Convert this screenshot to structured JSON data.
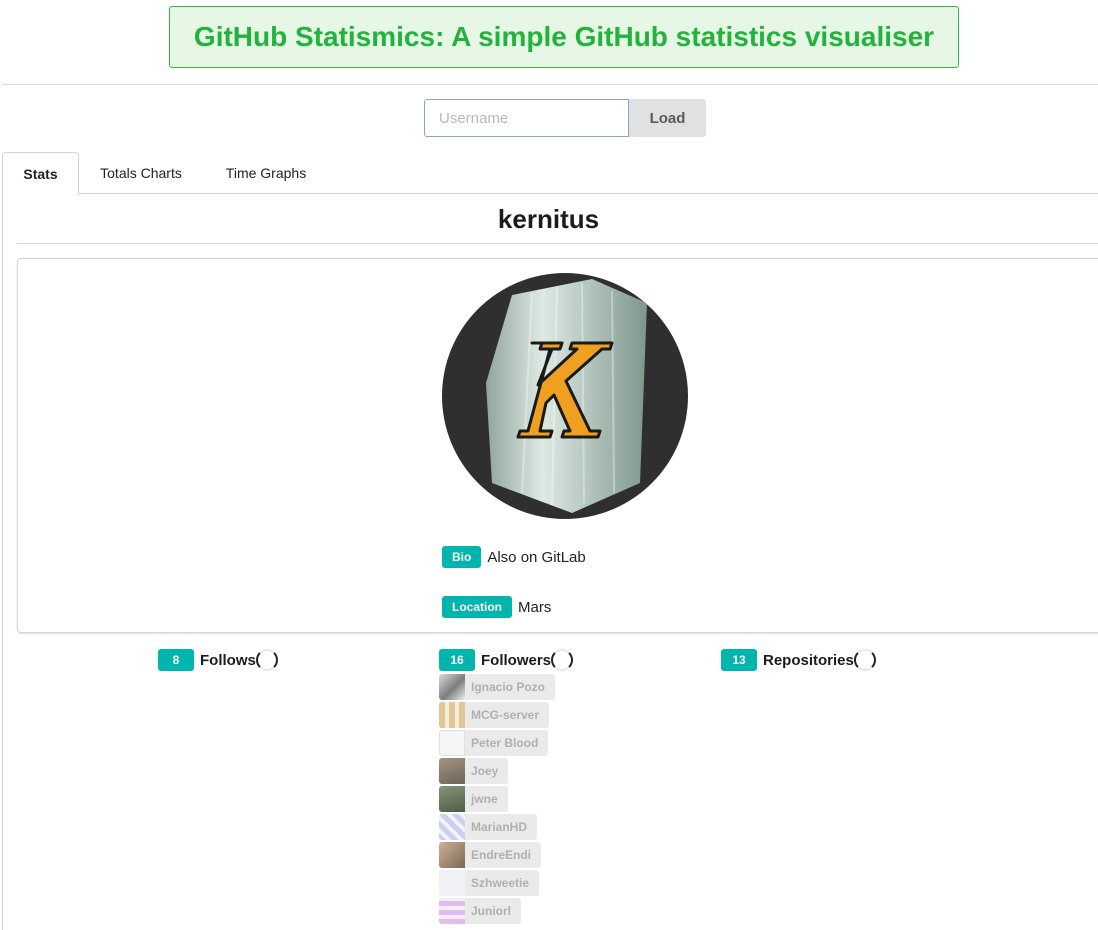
{
  "header": {
    "title": "GitHub Statismics: A simple GitHub statistics visualiser"
  },
  "search": {
    "placeholder": "Username",
    "value": "",
    "load_label": "Load"
  },
  "tabs": [
    {
      "label": "Stats",
      "active": true
    },
    {
      "label": "Totals Charts",
      "active": false
    },
    {
      "label": "Time Graphs",
      "active": false
    }
  ],
  "profile": {
    "username": "kernitus",
    "avatar_letter": "K",
    "bio_label": "Bio",
    "bio": "Also on GitLab",
    "location_label": "Location",
    "location": "Mars"
  },
  "stats": {
    "follows": {
      "count": "8",
      "label": "Follows"
    },
    "followers": {
      "count": "16",
      "label": "Followers"
    },
    "repositories": {
      "count": "13",
      "label": "Repositories"
    }
  },
  "followers_list": [
    {
      "name": "Ignacio Pozo",
      "icon": "person-photo-icon"
    },
    {
      "name": "MCG-server",
      "icon": "identicon-icon"
    },
    {
      "name": "Peter Blood",
      "icon": "logo-icon"
    },
    {
      "name": "Joey",
      "icon": "person-photo-icon"
    },
    {
      "name": "jwne",
      "icon": "person-photo-icon"
    },
    {
      "name": "MarianHD",
      "icon": "identicon-icon"
    },
    {
      "name": "EndreEndi",
      "icon": "photo-icon"
    },
    {
      "name": "Szhweetie",
      "icon": "logo-icon"
    },
    {
      "name": "Juniorl",
      "icon": "identicon-icon"
    }
  ],
  "colors": {
    "brand_green": "#22b33c",
    "teal": "#00b5ad",
    "avatar_orange": "#f0a020"
  }
}
